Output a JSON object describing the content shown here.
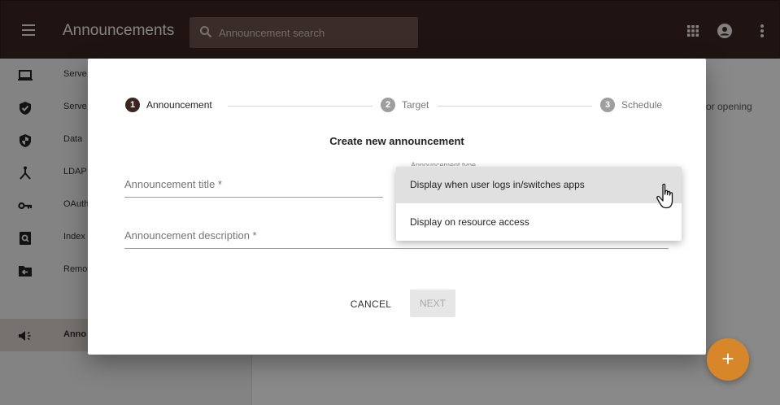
{
  "appbar": {
    "title": "Announcements",
    "search_placeholder": "Announcement search"
  },
  "sidebar": {
    "items": [
      {
        "label": "Serve",
        "icon": "laptop-icon"
      },
      {
        "label": "Serve",
        "icon": "shield-check-icon"
      },
      {
        "label": "Data",
        "icon": "shield-half-icon"
      },
      {
        "label": "LDAP",
        "icon": "hierarchy-icon"
      },
      {
        "label": "OAuth",
        "icon": "key-icon"
      },
      {
        "label": "Index",
        "icon": "search-document-icon"
      },
      {
        "label": "Remo",
        "icon": "folder-arrow-icon"
      },
      {
        "label": "Anno",
        "icon": "megaphone-icon"
      }
    ]
  },
  "background_text": "or opening",
  "dialog": {
    "steps": [
      {
        "num": "1",
        "label": "Announcement"
      },
      {
        "num": "2",
        "label": "Target"
      },
      {
        "num": "3",
        "label": "Schedule"
      }
    ],
    "title": "Create new announcement",
    "title_field_label": "Announcement title *",
    "description_field_label": "Announcement description *",
    "type_field_label": "Announcement type",
    "cancel_label": "CANCEL",
    "next_label": "NEXT"
  },
  "dropdown": {
    "options": [
      "Display when user logs in/switches apps",
      "Display on resource access"
    ],
    "highlighted_index": 0
  },
  "fab_label": "+",
  "colors": {
    "appbar": "#3a2522",
    "accent": "#d7872a",
    "step_active": "#3a2522",
    "step_inactive": "#9e9e9e"
  }
}
